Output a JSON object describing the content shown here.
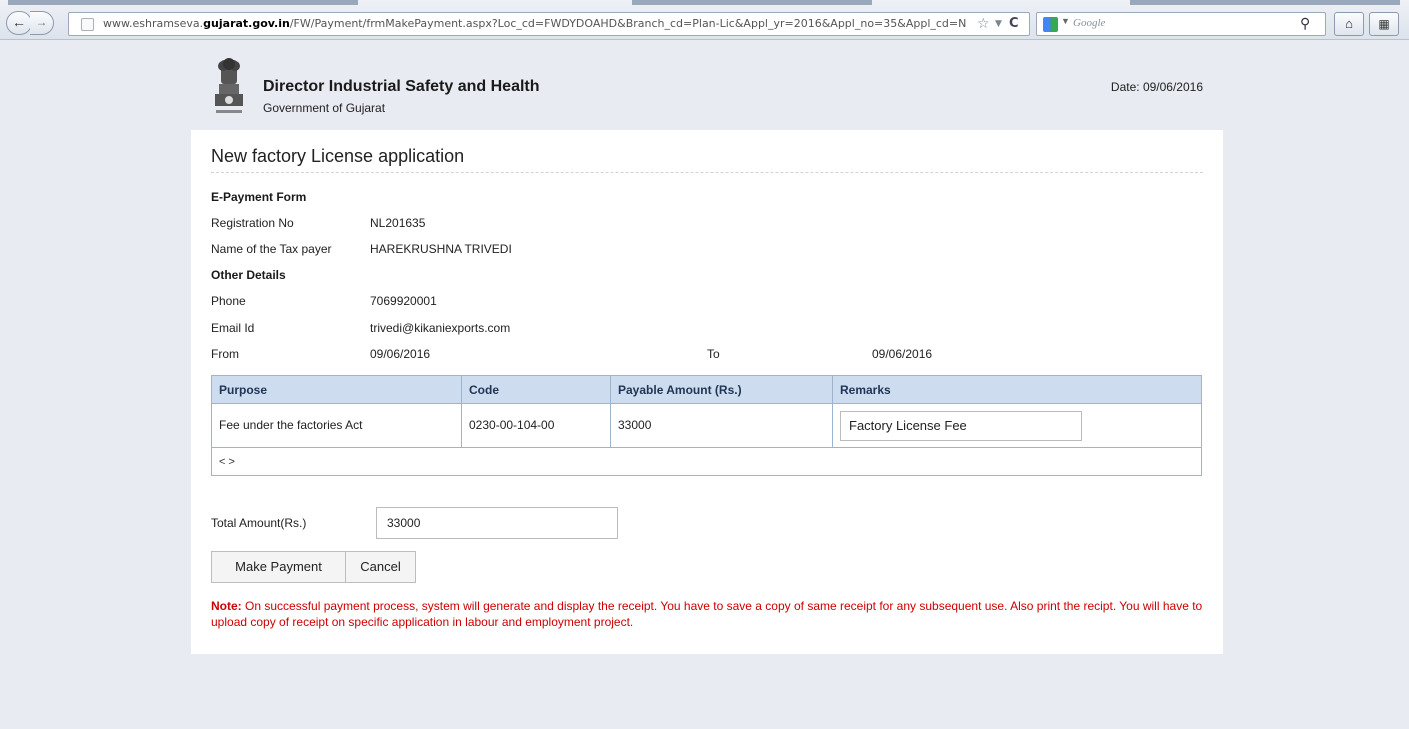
{
  "browser": {
    "url_prefix": "www.eshramseva.",
    "url_domain": "gujarat.gov.in",
    "url_path": "/FW/Payment/frmMakePayment.aspx?Loc_cd=FWDYDOAHD&Branch_cd=Plan-Lic&Appl_yr=2016&Appl_no=35&Appl_cd=N",
    "search_placeholder": "Google",
    "icons": [
      "back-icon",
      "forward-icon",
      "star-icon",
      "reload-icon",
      "search-icon",
      "home-icon",
      "addon-icon"
    ]
  },
  "header": {
    "org_name": "Director Industrial Safety and Health",
    "org_sub": "Government of Gujarat",
    "date": "Date: 09/06/2016"
  },
  "page": {
    "title": "New factory License application"
  },
  "form": {
    "section1": "E-Payment Form",
    "registration_label": "Registration No",
    "registration_value": "NL201635",
    "taxpayer_label": "Name of the Tax payer",
    "taxpayer_value": "HAREKRUSHNA TRIVEDI",
    "section2": "Other Details",
    "phone_label": "Phone",
    "phone_value": "7069920001",
    "email_label": "Email Id",
    "email_value": "trivedi@kikaniexports.com",
    "from_label": "From",
    "from_value": "09/06/2016",
    "to_label": "To",
    "to_value": "09/06/2016"
  },
  "grid": {
    "headers": [
      "Purpose",
      "Code",
      "Payable Amount (Rs.)",
      "Remarks"
    ],
    "rows": [
      {
        "purpose": "Fee under the factories Act",
        "code": "0230-00-104-00",
        "amount": "33000",
        "remarks": "Factory License Fee"
      }
    ],
    "pager": "< >"
  },
  "total": {
    "label": "Total Amount(Rs.)",
    "value": "33000"
  },
  "buttons": {
    "pay": "Make Payment",
    "cancel": "Cancel"
  },
  "note": {
    "prefix": "Note:",
    "text": " On successful payment process, system will generate and display the receipt. You have to save a copy of same receipt for any subsequent use. Also print the recipt. You will have to upload copy of receipt on specific application in labour and employment project."
  },
  "colors": {
    "page_bg": "#e8ebf2",
    "grid_header_bg": "#cddcef",
    "note_color": "#d00000"
  }
}
